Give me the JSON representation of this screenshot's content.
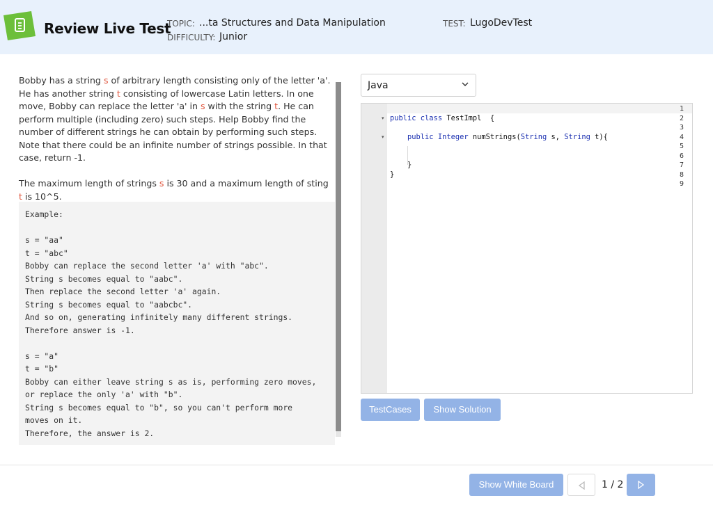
{
  "header": {
    "app_title": "Review Live Test",
    "topic_label": "TOPIC:",
    "topic_value": "...ta Structures and Data Manipulation",
    "difficulty_label": "DIFFICULTY:",
    "difficulty_value": "Junior",
    "test_label": "TEST:",
    "test_value": "LugoDevTest",
    "logo_color": "#6cbf3a"
  },
  "problem": {
    "p1_a": "Bobby has a string ",
    "p1_var1": "s",
    "p1_b": " of arbitrary length consisting only of the letter 'a'. He has another string ",
    "p1_var2": "t",
    "p1_c": " consisting of lowercase Latin letters. In one move, Bobby can replace the letter 'a' in ",
    "p1_var3": "s",
    "p1_d": " with the string ",
    "p1_var4": "t",
    "p1_e": ". He can perform multiple (including zero) such steps. Help Bobby find the number of different strings he can obtain by performing such steps. Note that there could be an infinite number of strings possible. In that case, return -1.",
    "p2_a": "The maximum length of strings ",
    "p2_var1": "s",
    "p2_b": " is 30 and a maximum length of sting ",
    "p2_var2": "t",
    "p2_c": " is 10^5.",
    "example": "Example:\n\ns = \"aa\"\nt = \"abc\"\nBobby can replace the second letter 'a' with \"abc\".\nString s becomes equal to \"aabc\".\nThen replace the second letter 'a' again.\nString s becomes equal to \"aabcbc\".\nAnd so on, generating infinitely many different strings.\nTherefore answer is -1.\n\ns = \"a\"\nt = \"b\"\nBobby can either leave string s as is, performing zero moves,\nor replace the only 'a' with \"b\".\nString s becomes equal to \"b\", so you can't perform more\nmoves on it.\nTherefore, the answer is 2.",
    "highlight_color": "#e0573f"
  },
  "language_select": {
    "selected": "Java"
  },
  "editor": {
    "line_numbers": [
      "1",
      "2",
      "3",
      "4",
      "5",
      "6",
      "7",
      "8",
      "9"
    ],
    "code": {
      "l2_kw": "public class",
      "l2_rest": " TestImpl  {",
      "l4_kw1": "public",
      "l4_kw2": "Integer",
      "l4_mid": " numStrings(",
      "l4_kw3": "String",
      "l4_mid2": " s, ",
      "l4_kw4": "String",
      "l4_end": " t){",
      "l7": "}",
      "l8": "}"
    }
  },
  "buttons": {
    "test_cases": "TestCases",
    "show_solution": "Show Solution",
    "show_white_board": "Show White Board"
  },
  "pager": {
    "text": "1 / 2"
  },
  "colors": {
    "header_bg": "#e8f1fc",
    "button_bg": "#93b3e6",
    "keyword": "#1a2fb0"
  }
}
